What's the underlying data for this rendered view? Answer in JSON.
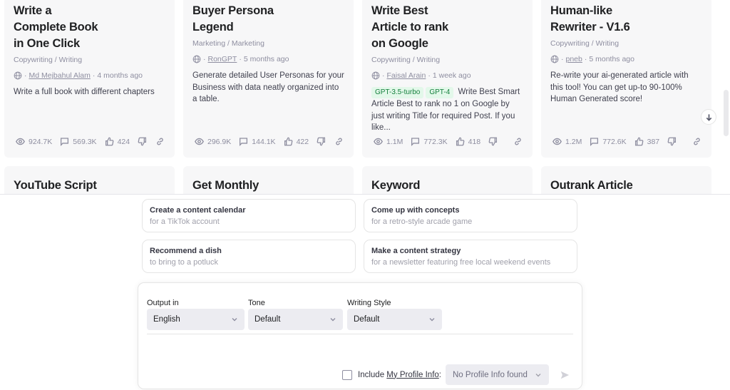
{
  "cards_row1": [
    {
      "title_lines": [
        "Write a",
        "Complete Book",
        "in One Click"
      ],
      "category": "Copywriting / Writing",
      "author": "Md Mejbahul Alam",
      "time": "4 months ago",
      "badges": [],
      "description": "Write a full book with different chapters",
      "views": "924.7K",
      "comments": "569.3K",
      "likes": "424"
    },
    {
      "title_lines": [
        "Buyer Persona",
        "Legend"
      ],
      "category": "Marketing / Marketing",
      "author": "RonGPT",
      "time": "5 months ago",
      "badges": [],
      "description": "Generate detailed User Personas for your Business with data neatly organized into a table.",
      "views": "296.9K",
      "comments": "144.1K",
      "likes": "422"
    },
    {
      "title_lines": [
        "Write Best",
        "Article to rank",
        "on Google"
      ],
      "category": "Copywriting / Writing",
      "author": "Faisal Arain",
      "time": "1 week ago",
      "badges": [
        "GPT-3.5-turbo",
        "GPT-4"
      ],
      "description": "Write Best Smart Article Best to rank no 1 on Google by just writing Title for required Post. If you like...",
      "views": "1.1M",
      "comments": "772.3K",
      "likes": "418"
    },
    {
      "title_lines": [
        "Human-like",
        "Rewriter - V1.6"
      ],
      "category": "Copywriting / Writing",
      "author": "pneb",
      "time": "5 months ago",
      "badges": [],
      "description": "Re-write your ai-generated article with this tool! You can get up-to 90-100% Human Generated score!",
      "views": "1.2M",
      "comments": "772.6K",
      "likes": "387"
    }
  ],
  "cards_row2": [
    {
      "title": "YouTube Script"
    },
    {
      "title": "Get Monthly"
    },
    {
      "title": "Keyword"
    },
    {
      "title": "Outrank Article"
    }
  ],
  "meta_separator": "·",
  "suggestions": [
    {
      "title": "Create a content calendar",
      "subtitle": "for a TikTok account"
    },
    {
      "title": "Come up with concepts",
      "subtitle": "for a retro-style arcade game"
    },
    {
      "title": "Recommend a dish",
      "subtitle": "to bring to a potluck"
    },
    {
      "title": "Make a content strategy",
      "subtitle": "for a newsletter featuring free local weekend events"
    }
  ],
  "composer": {
    "output_label": "Output in",
    "output_value": "English",
    "tone_label": "Tone",
    "tone_value": "Default",
    "style_label": "Writing Style",
    "style_value": "Default",
    "include_prefix": "Include ",
    "include_link": "My Profile Info",
    "include_suffix": ":",
    "profile_value": "No Profile Info found",
    "include_checked": false
  },
  "colors": {
    "card_bg": "#f7f7f8",
    "badge_bg": "#e3f8ea",
    "badge_text": "#15803d",
    "muted_text": "#8e8ea0"
  }
}
